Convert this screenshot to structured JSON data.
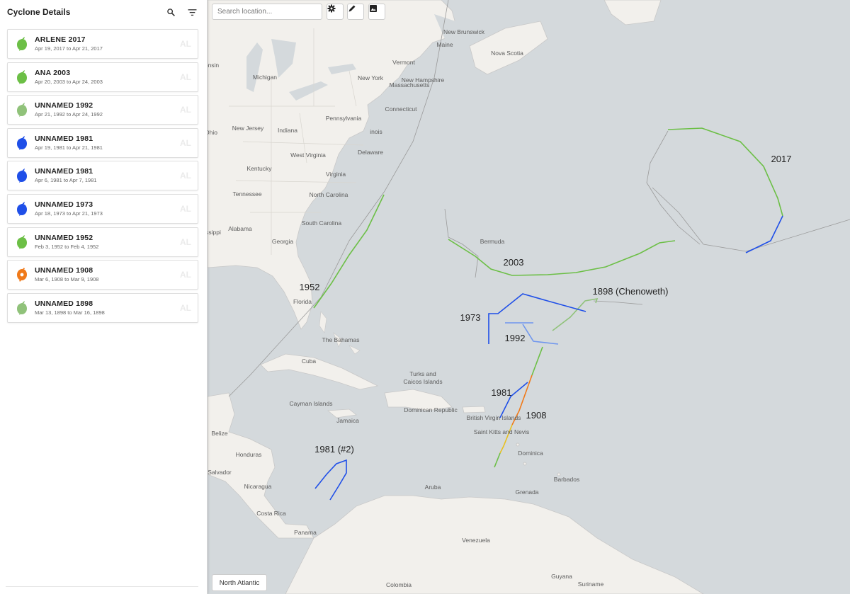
{
  "sidebar": {
    "title": "Cyclone Details",
    "storms": [
      {
        "name": "ARLENE 2017",
        "dates": "Apr 19, 2017 to Apr 21, 2017",
        "basin": "AL",
        "color": "#6cbf46",
        "icon": "tropical-storm-icon"
      },
      {
        "name": "ANA 2003",
        "dates": "Apr 20, 2003 to Apr 24, 2003",
        "basin": "AL",
        "color": "#6cbf46",
        "icon": "tropical-storm-icon"
      },
      {
        "name": "UNNAMED 1992",
        "dates": "Apr 21, 1992 to Apr 24, 1992",
        "basin": "AL",
        "color": "#90c27a",
        "icon": "subtropical-storm-icon"
      },
      {
        "name": "UNNAMED 1981",
        "dates": "Apr 19, 1981 to Apr 21, 1981",
        "basin": "AL",
        "color": "#1f4fe8",
        "icon": "tropical-depression-icon"
      },
      {
        "name": "UNNAMED 1981",
        "dates": "Apr 6, 1981 to Apr 7, 1981",
        "basin": "AL",
        "color": "#1f4fe8",
        "icon": "tropical-depression-icon"
      },
      {
        "name": "UNNAMED 1973",
        "dates": "Apr 18, 1973 to Apr 21, 1973",
        "basin": "AL",
        "color": "#1f4fe8",
        "icon": "tropical-depression-icon"
      },
      {
        "name": "UNNAMED 1952",
        "dates": "Feb 3, 1952 to Feb 4, 1952",
        "basin": "AL",
        "color": "#6cbf46",
        "icon": "tropical-storm-icon"
      },
      {
        "name": "UNNAMED 1908",
        "dates": "Mar 6, 1908 to Mar 9, 1908",
        "basin": "AL",
        "color": "#f07a1a",
        "icon": "hurricane-icon"
      },
      {
        "name": "UNNAMED 1898",
        "dates": "Mar 13, 1898 to Mar 16, 1898",
        "basin": "AL",
        "color": "#90c27a",
        "icon": "subtropical-storm-icon"
      }
    ]
  },
  "map": {
    "search_placeholder": "Search location...",
    "basin_button": "North Atlantic",
    "places": [
      "New Brunswick",
      "Maine",
      "Nova Scotia",
      "Vermont",
      "New Hampshire",
      "New York",
      "Massachusetts",
      "Michigan",
      "Connecticut",
      "onsin",
      "Pennsylvania",
      "New Jersey",
      "Indiana",
      "Ohio",
      "inois",
      "Delaware",
      "West Virginia",
      "Kentucky",
      "Virginia",
      "Tennessee",
      "North Carolina",
      "South Carolina",
      "Alabama",
      "Georgia",
      "ssippi",
      "Bermuda",
      "Florida",
      "The Bahamas",
      "Cuba",
      "Turks and",
      "Caicos Islands",
      "Cayman Islands",
      "Dominican Republic",
      "Jamaica",
      "British Virgin Islands",
      "Saint Kitts and Nevis",
      "Belize",
      "Honduras",
      "Dominica",
      "Salvador",
      "Nicaragua",
      "Barbados",
      "Aruba",
      "Grenada",
      "Costa Rica",
      "Panama",
      "Venezuela",
      "Guyana",
      "Suriname",
      "Colombia"
    ],
    "track_labels": [
      "2017",
      "2003",
      "1952",
      "1898 (Chenoweth)",
      "1973",
      "1992",
      "1981",
      "1908",
      "1981 (#2)"
    ],
    "colors": {
      "water": "#d4d9dc",
      "land": "#f2f0ec",
      "border": "#c8c8c8",
      "tropical_storm": "#6cbf46",
      "depression": "#1f4fe8",
      "hurricane": "#f07a1a",
      "cat_weak": "#e8c020",
      "extratropical": "#9a9a9a"
    }
  }
}
